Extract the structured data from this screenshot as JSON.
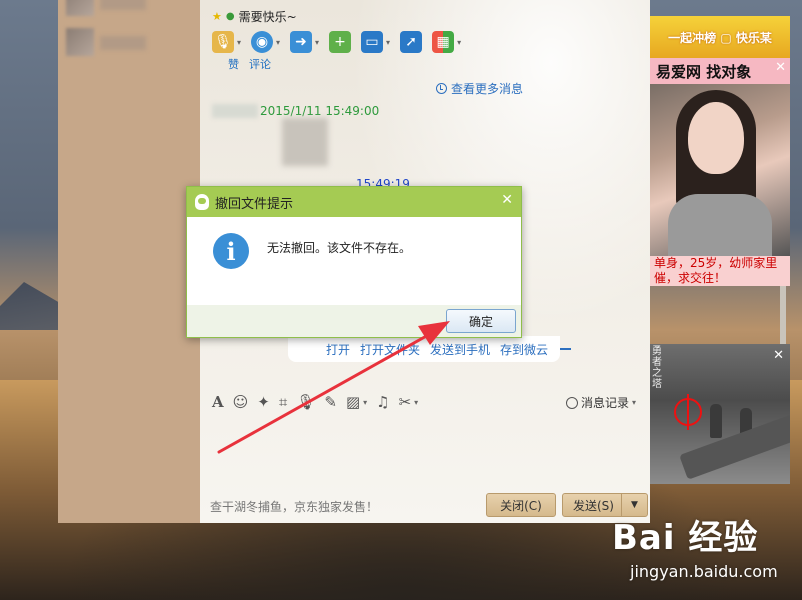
{
  "chat": {
    "title": "需要快乐~",
    "links": [
      "赞",
      "评论"
    ],
    "more_messages": "查看更多消息",
    "message_time_1": "2015/1/11 15:49:00",
    "message_time_2": "15:49:19",
    "file_actions": [
      "打开",
      "打开文件夹",
      "发送到手机",
      "存到微云"
    ],
    "history_label": "消息记录",
    "ad_text": "查干湖冬捕鱼，京东独家发售！",
    "close_label": "关闭(C)",
    "send_label": "发送(S)"
  },
  "toolbar": {
    "icons": [
      "microphone-icon",
      "video-icon",
      "file-transfer-icon",
      "add-member-icon",
      "remote-desktop-icon",
      "share-screen-icon",
      "apps-icon"
    ]
  },
  "input_toolbar": {
    "icons": [
      "font-icon",
      "emoji-icon",
      "magic-icon",
      "screenshot-icon",
      "voice-icon",
      "edit-icon",
      "image-icon",
      "music-icon",
      "scissors-icon"
    ]
  },
  "dialog": {
    "title": "撤回文件提示",
    "message": "无法撤回。该文件不存在。",
    "ok_label": "确定"
  },
  "ads": {
    "top_banner": "一起冲榜 ▢ 快乐某",
    "top_header": "易爱网  找对象",
    "top_caption": "单身，25岁，幼师家里催，求交往！",
    "game_logo": "勇者之塔"
  },
  "watermark": {
    "logo": "Bai 经验",
    "url": "jingyan.baidu.com"
  },
  "colors": {
    "dialog_title_bg": "#a5cb53",
    "info_icon": "#3a8fd6",
    "link_blue": "#2c6fbf",
    "time_green": "#2e9a3c",
    "time_blue": "#2147c9",
    "arrow_red": "#e8323c"
  }
}
